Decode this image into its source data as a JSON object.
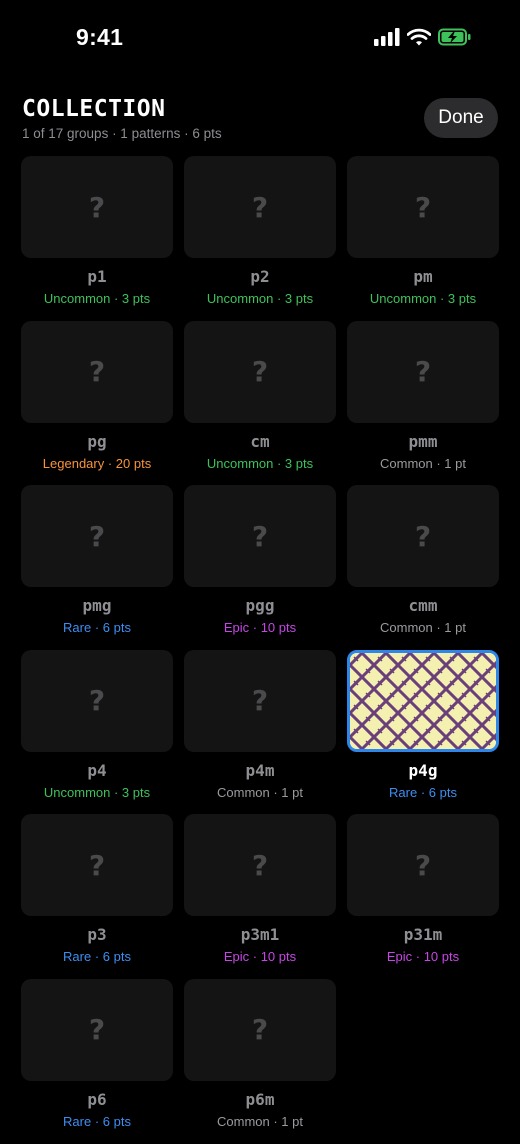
{
  "status_bar": {
    "time": "9:41"
  },
  "header": {
    "title": "COLLECTION",
    "subtitle": "1 of 17 groups · 1 patterns · 6 pts",
    "done_label": "Done"
  },
  "locked_symbol": "?",
  "groups": [
    {
      "name": "p1",
      "meta": "Uncommon · 3 pts",
      "rarity": "Uncommon",
      "unlocked": false
    },
    {
      "name": "p2",
      "meta": "Uncommon · 3 pts",
      "rarity": "Uncommon",
      "unlocked": false
    },
    {
      "name": "pm",
      "meta": "Uncommon · 3 pts",
      "rarity": "Uncommon",
      "unlocked": false
    },
    {
      "name": "pg",
      "meta": "Legendary · 20 pts",
      "rarity": "Legendary",
      "unlocked": false
    },
    {
      "name": "cm",
      "meta": "Uncommon · 3 pts",
      "rarity": "Uncommon",
      "unlocked": false
    },
    {
      "name": "pmm",
      "meta": "Common · 1 pt",
      "rarity": "Common",
      "unlocked": false
    },
    {
      "name": "pmg",
      "meta": "Rare · 6 pts",
      "rarity": "Rare",
      "unlocked": false
    },
    {
      "name": "pgg",
      "meta": "Epic · 10 pts",
      "rarity": "Epic",
      "unlocked": false
    },
    {
      "name": "cmm",
      "meta": "Common · 1 pt",
      "rarity": "Common",
      "unlocked": false
    },
    {
      "name": "p4",
      "meta": "Uncommon · 3 pts",
      "rarity": "Uncommon",
      "unlocked": false
    },
    {
      "name": "p4m",
      "meta": "Common · 1 pt",
      "rarity": "Common",
      "unlocked": false
    },
    {
      "name": "p4g",
      "meta": "Rare · 6 pts",
      "rarity": "Rare",
      "unlocked": true
    },
    {
      "name": "p3",
      "meta": "Rare · 6 pts",
      "rarity": "Rare",
      "unlocked": false
    },
    {
      "name": "p3m1",
      "meta": "Epic · 10 pts",
      "rarity": "Epic",
      "unlocked": false
    },
    {
      "name": "p31m",
      "meta": "Epic · 10 pts",
      "rarity": "Epic",
      "unlocked": false
    },
    {
      "name": "p6",
      "meta": "Rare · 6 pts",
      "rarity": "Rare",
      "unlocked": false
    },
    {
      "name": "p6m",
      "meta": "Common · 1 pt",
      "rarity": "Common",
      "unlocked": false
    }
  ],
  "colors": {
    "accent": "#2d86e8",
    "uncommon": "#3ec15a",
    "legendary": "#f5943b",
    "common": "#9a9a9f",
    "rare": "#3d8ef2",
    "epic": "#c746e6",
    "pattern_bg": "#f3f0b0",
    "pattern_fg": "#6a3f7a"
  },
  "icons": [
    "cellular-signal-icon",
    "wifi-icon",
    "battery-charging-icon"
  ]
}
